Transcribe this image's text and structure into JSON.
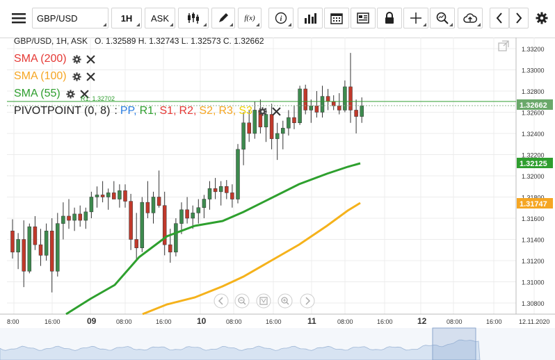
{
  "toolbar": {
    "symbol": "GBP/USD",
    "interval": "1H",
    "price_type": "ASK",
    "icons": [
      "menu-icon",
      "candlestick-icon",
      "pencil-icon",
      "function-icon",
      "info-icon",
      "bar-chart-icon",
      "calendar-icon",
      "news-icon",
      "lock-icon",
      "crosshair-icon",
      "zoom-icon",
      "cloud-upload-icon",
      "arrow-left-icon",
      "arrow-right-icon",
      "gear-icon"
    ]
  },
  "ohlc": {
    "header": "GBP/USD, 1H, ASK",
    "text": "O. 1.32589 H. 1.32743 L. 1.32573 C. 1.32662"
  },
  "indicators": [
    {
      "label": "SMA (200)",
      "color": "#e53935"
    },
    {
      "label": "SMA (100)",
      "color": "#f5a623"
    },
    {
      "label": "SMA (55)",
      "color": "#2e9e2e"
    }
  ],
  "pivot": {
    "label": "PIVOTPOINT (0, 8)",
    "separator": ":",
    "parts": [
      {
        "text": "PP,",
        "color": "#2a7de1"
      },
      {
        "text": "R1,",
        "color": "#2e9e2e"
      },
      {
        "text": "S1,",
        "color": "#e53935"
      },
      {
        "text": "R2,",
        "color": "#e53935"
      },
      {
        "text": "S2,",
        "color": "#f5a623"
      },
      {
        "text": "R3,",
        "color": "#f5a623"
      },
      {
        "text": "S3",
        "color": "#f0d000"
      }
    ],
    "r1_label": "R1: 1.32702"
  },
  "price_axis": {
    "ticks": [
      "1.33200",
      "1.33000",
      "1.32800",
      "1.32600",
      "1.32400",
      "1.32200",
      "1.32000",
      "1.31800",
      "1.31600",
      "1.31400",
      "1.31200",
      "1.31000",
      "1.30800"
    ],
    "last_price": "1.32662",
    "sma55_value": "1.32125",
    "sma100_value": "1.31747",
    "last_color": "#6aa86a",
    "sma55_color": "#2e9e2e",
    "sma100_color": "#f5a623"
  },
  "time_axis": {
    "labels": [
      {
        "text": "8:00",
        "bold": false
      },
      {
        "text": "16:00",
        "bold": false
      },
      {
        "text": "09",
        "bold": true
      },
      {
        "text": "08:00",
        "bold": false
      },
      {
        "text": "16:00",
        "bold": false
      },
      {
        "text": "10",
        "bold": true
      },
      {
        "text": "08:00",
        "bold": false
      },
      {
        "text": "16:00",
        "bold": false
      },
      {
        "text": "11",
        "bold": true
      },
      {
        "text": "08:00",
        "bold": false
      },
      {
        "text": "16:00",
        "bold": false
      },
      {
        "text": "12",
        "bold": true
      },
      {
        "text": "08:00",
        "bold": false
      },
      {
        "text": "16:00",
        "bold": false
      },
      {
        "text": "12.11.2020",
        "bold": false
      }
    ]
  },
  "colors": {
    "bull": "#3d8a4e",
    "bear": "#c0392b",
    "sma55": "#2ea02e",
    "sma100": "#f5b21b",
    "grid": "#ececec"
  }
}
